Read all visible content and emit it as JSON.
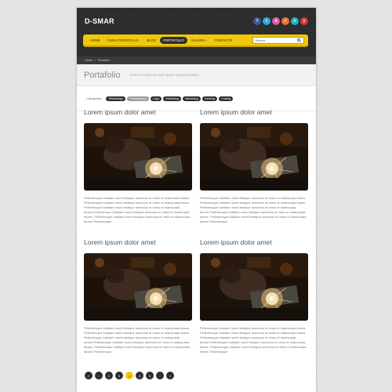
{
  "logo": "D-SMAR",
  "social": [
    {
      "icon": "facebook-icon",
      "glyph": "f",
      "color": "#3b5998"
    },
    {
      "icon": "twitter-icon",
      "glyph": "t",
      "color": "#29a9e1"
    },
    {
      "icon": "dribbble-icon",
      "glyph": "d",
      "color": "#e0599a"
    },
    {
      "icon": "rss-icon",
      "glyph": "r",
      "color": "#e6753a"
    },
    {
      "icon": "vimeo-icon",
      "glyph": "v",
      "color": "#2ab0c5"
    },
    {
      "icon": "youtube-icon",
      "glyph": "y",
      "color": "#d13a3a"
    }
  ],
  "nav": {
    "items": [
      {
        "label": "Home",
        "active": false
      },
      {
        "label": "Caracteristicas ›",
        "active": false
      },
      {
        "label": "Blog",
        "active": false
      },
      {
        "label": "Portafolio",
        "active": true
      },
      {
        "label": "Galeria ›",
        "active": false
      },
      {
        "label": "Contacto",
        "active": false
      }
    ],
    "search_placeholder": "Buscar..."
  },
  "breadcrumb": {
    "home": "Home",
    "separator": "›",
    "current": "Portafolio"
  },
  "page": {
    "title": "Portafolio",
    "subtitle": "Donec eu libero sit amet quam egestas semper."
  },
  "filters": {
    "label": "Categorias:",
    "items": [
      {
        "label": "Webdesign",
        "active": false
      },
      {
        "label": "Photography",
        "active": true
      },
      {
        "label": "Logo",
        "active": false
      },
      {
        "label": "Marketing",
        "active": false
      },
      {
        "label": "Marketing",
        "active": false
      },
      {
        "label": "Gaming",
        "active": false
      },
      {
        "label": "Coding",
        "active": false
      }
    ]
  },
  "posts": [
    {
      "title": "Lorem ipsum dolor amet",
      "text": "Pellentesque habitant morbi tristique senectus et netus et malesuada fames. Pellentesque habitant morbi tristique senectus et netus et malesuada fames Pellentesque habitant morbi tristique senectus et netus et malesuada fames.Pellentesque habitant morbi tristique senectus et netus et malesuada fames. Pellentesque habitant morbi tristique senectus et netus et malesuada fames Pellentesque"
    },
    {
      "title": "Lorem ipsum dolor amet",
      "text": "Pellentesque habitant morbi tristique senectus et netus et malesuada fames. Pellentesque habitant morbi tristique senectus et netus et malesuada fames Pellentesque habitant morbi tristique senectus et netus et malesuada fames.Pellentesque habitant morbi tristique senectus et netus et malesuada fames. Pellentesque habitant morbi tristique senectus et netus et malesuada fames Pellentesque"
    },
    {
      "title": "Lorem ipsum dolor amet",
      "text": "Pellentesque habitant morbi tristique senectus et netus et malesuada fames. Pellentesque habitant morbi tristique senectus et netus et malesuada fames Pellentesque habitant morbi tristique senectus et netus et malesuada fames.Pellentesque habitant morbi tristique senectus et netus et malesuada fames. Pellentesque habitant morbi tristique senectus et netus et malesuada fames Pellentesque"
    },
    {
      "title": "Lorem ipsum dolor amet",
      "text": "Pellentesque habitant morbi tristique senectus et netus et malesuada fames. Pellentesque habitant morbi tristique senectus et netus et malesuada fames Pellentesque habitant morbi tristique senectus et netus et malesuada fames.Pellentesque habitant morbi tristique senectus et netus et malesuada fames. Pellentesque habitant morbi tristique senectus et netus et malesuada fames Pellentesque"
    }
  ],
  "pagination": {
    "prev": "«",
    "pages": [
      "‹",
      "2",
      "3",
      "4",
      "5",
      "6",
      "›"
    ],
    "next": "»",
    "active_index": 3
  }
}
